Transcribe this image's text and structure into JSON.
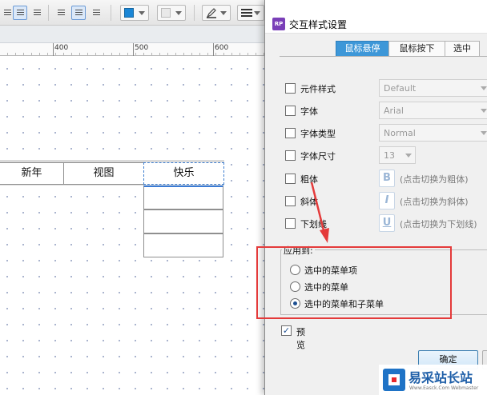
{
  "toolbar": {
    "items": [
      "align-left-icon",
      "align-center-icon",
      "align-right-icon",
      "valign-top-icon",
      "valign-middle-icon",
      "valign-bottom-icon",
      "fill-color-icon",
      "shadow-icon",
      "pen-icon",
      "line-style-icon"
    ]
  },
  "ruler": {
    "marks": [
      "400",
      "500",
      "600"
    ]
  },
  "menu": {
    "items": [
      "新年",
      "视图",
      "快乐"
    ],
    "submenu_rows": 3
  },
  "dialog": {
    "title": "交互样式设置",
    "icon_text": "RP",
    "tabs": [
      "鼠标悬停",
      "鼠标按下",
      "选中"
    ],
    "active_tab": 0,
    "properties": [
      {
        "label": "元件样式",
        "control": "combo",
        "value": "Default"
      },
      {
        "label": "字体",
        "control": "combo",
        "value": "Arial"
      },
      {
        "label": "字体类型",
        "control": "combo",
        "value": "Normal"
      },
      {
        "label": "字体尺寸",
        "control": "combo",
        "value": "13"
      },
      {
        "label": "粗体",
        "control": "button",
        "glyph": "B",
        "hint": "(点击切换为粗体)"
      },
      {
        "label": "斜体",
        "control": "button",
        "glyph": "I",
        "hint": "(点击切换为斜体)"
      },
      {
        "label": "下划线",
        "control": "button",
        "glyph": "U",
        "hint": "(点击切换为下划线)"
      }
    ],
    "apply_to": {
      "title": "应用到:",
      "options": [
        "选中的菜单项",
        "选中的菜单",
        "选中的菜单和子菜单"
      ],
      "selected": 2
    },
    "preview": {
      "label": "预览",
      "checked": true
    },
    "ok_label": "确定"
  },
  "watermark": {
    "name": "易采站长站",
    "url": "Www.Easck.Com Webmaster"
  },
  "colors": {
    "accent": "#3d97d8",
    "highlight": "#e43a3a",
    "fill_swatch": "#1a86d6"
  }
}
